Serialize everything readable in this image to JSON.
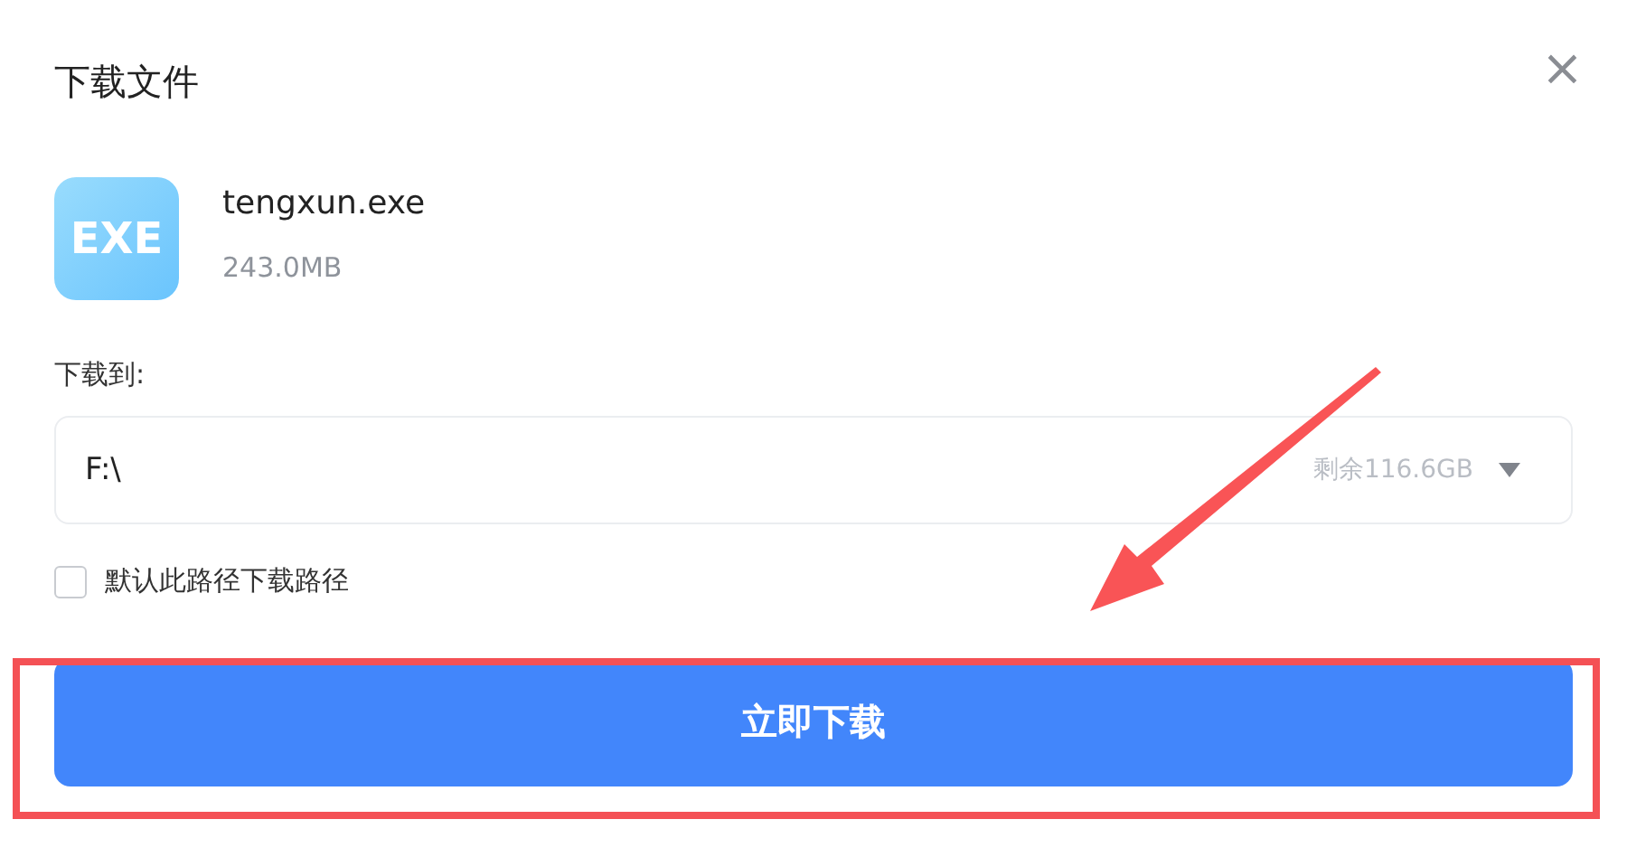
{
  "dialog": {
    "title": "下载文件",
    "close_glyph": "×"
  },
  "file": {
    "icon_text": "EXE",
    "name": "tengxun.exe",
    "size": "243.0MB"
  },
  "destination": {
    "label": "下载到:",
    "path": "F:\\",
    "free_space": "剩余116.6GB"
  },
  "default_path": {
    "label": "默认此路径下载路径",
    "checked": false
  },
  "download_button": {
    "label": "立即下载"
  },
  "annotations": {
    "highlight_frame": true,
    "arrow": true
  }
}
